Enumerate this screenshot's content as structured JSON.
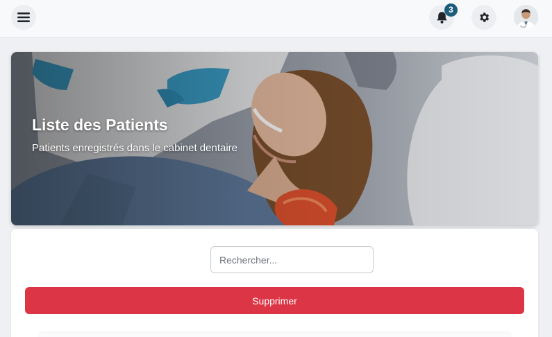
{
  "topbar": {
    "menu_icon": "hamburger-menu-icon",
    "notifications": {
      "icon": "bell-icon",
      "count": "3"
    },
    "settings_icon": "gear-icon",
    "avatar": "doctor-avatar"
  },
  "hero": {
    "title": "Liste des Patients",
    "subtitle": "Patients enregistrés dans le cabinet dentaire"
  },
  "search": {
    "placeholder": "Rechercher..."
  },
  "actions": {
    "delete_label": "Supprimer"
  },
  "colors": {
    "badge": "#1d5c7a",
    "danger": "#dc3545",
    "topbar_bg": "#f8f9fa",
    "page_bg": "#eef0f3"
  }
}
